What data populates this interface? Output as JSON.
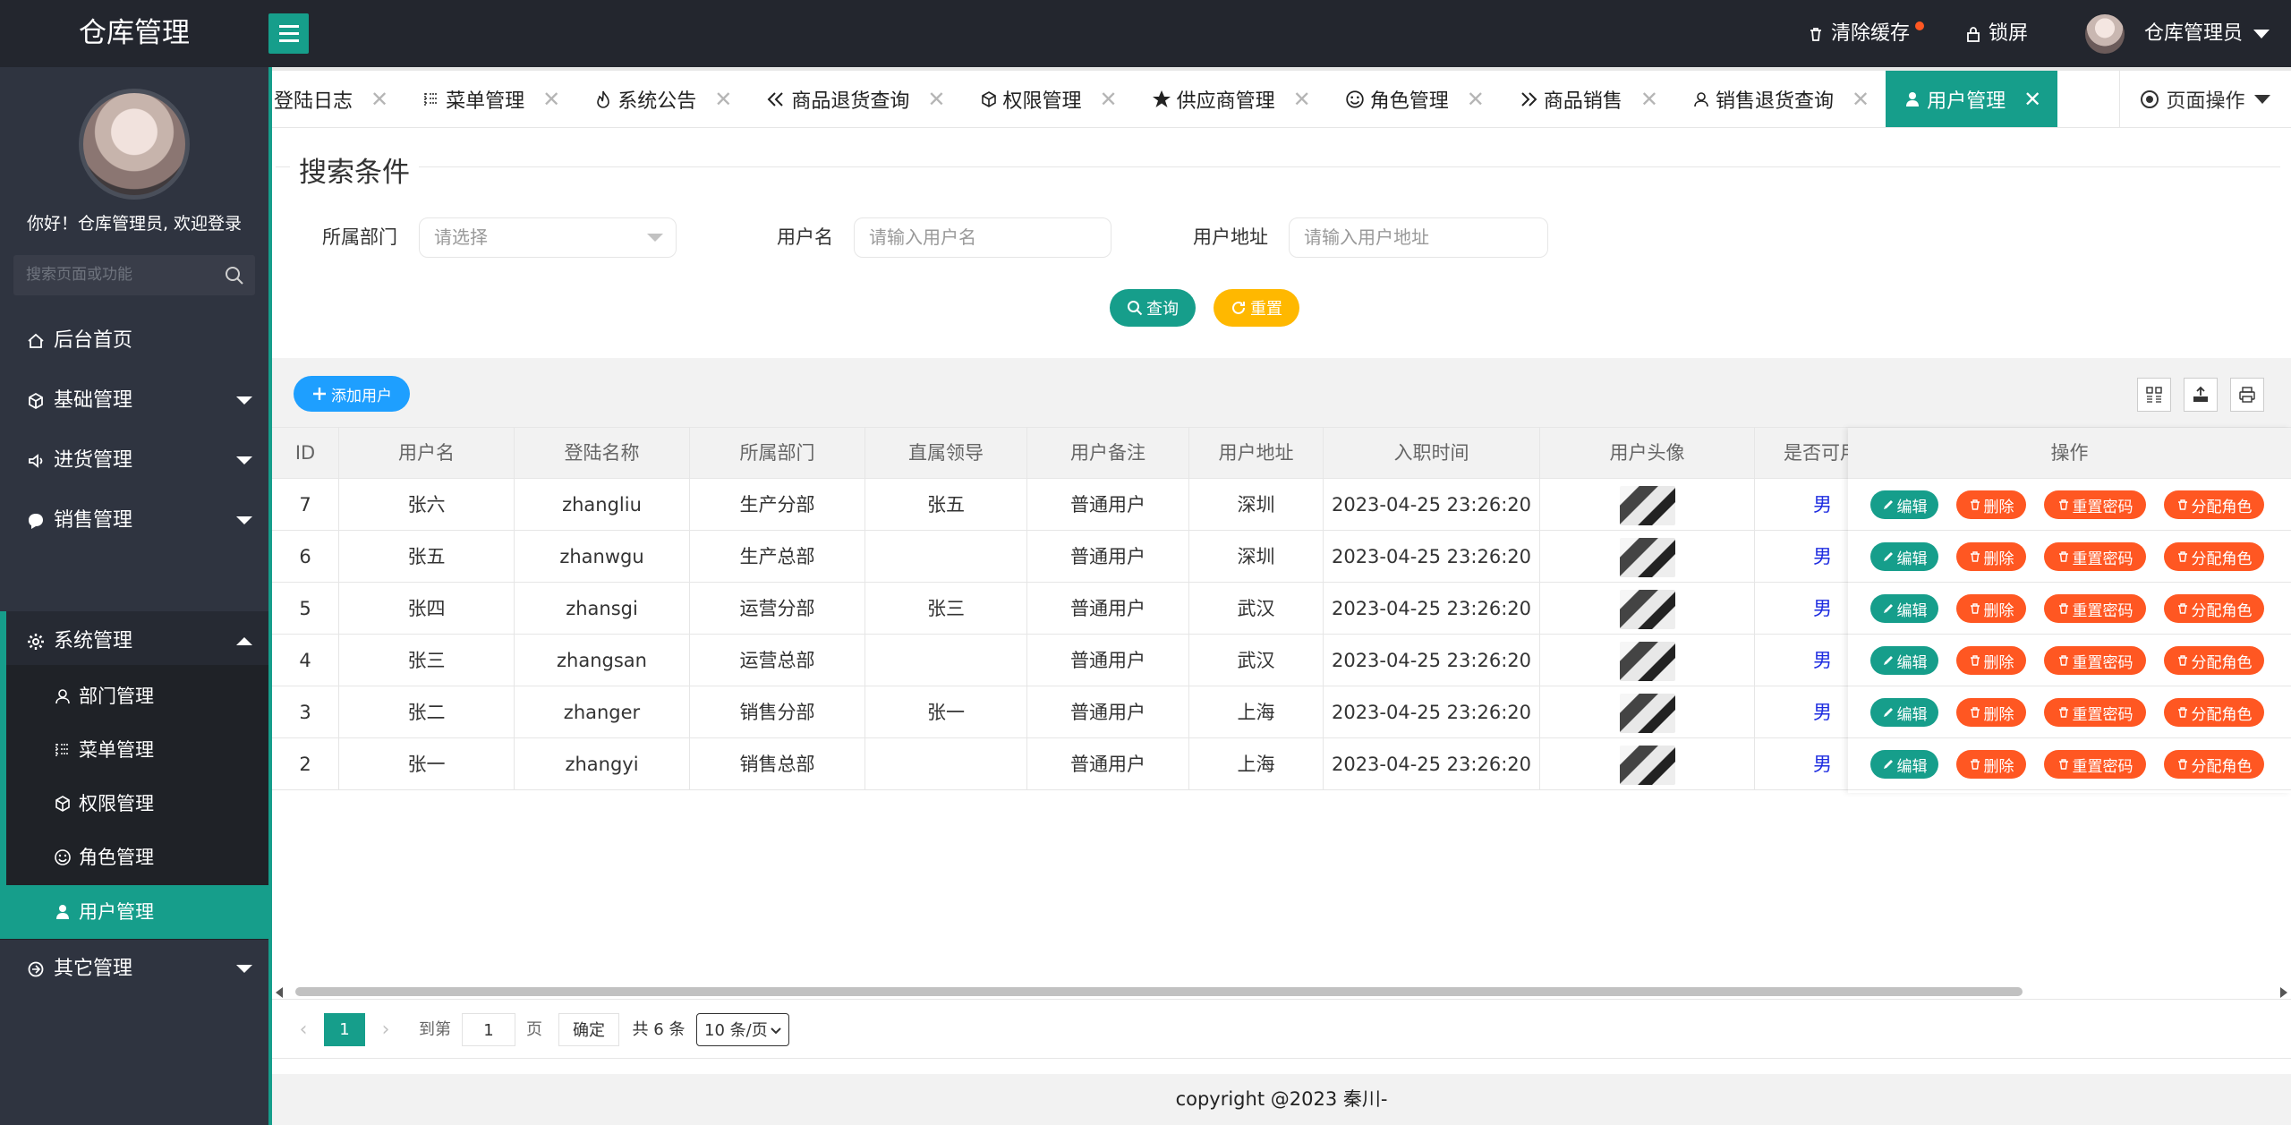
{
  "app": {
    "title": "仓库管理"
  },
  "header": {
    "clear_cache": "清除缓存",
    "lock_screen": "锁屏",
    "user": "仓库管理员"
  },
  "sidebar": {
    "welcome": "你好！仓库管理员, 欢迎登录",
    "search_placeholder": "搜索页面或功能",
    "items": [
      {
        "label": "后台首页",
        "icon": "home-icon"
      },
      {
        "label": "基础管理",
        "icon": "cube-icon"
      },
      {
        "label": "进货管理",
        "icon": "volume-icon"
      },
      {
        "label": "销售管理",
        "icon": "chat-icon"
      },
      {
        "label": "系统管理",
        "icon": "gear-icon"
      },
      {
        "label": "其它管理",
        "icon": "refresh-icon"
      }
    ],
    "sub_items": [
      {
        "label": "部门管理",
        "icon": "user-outline-icon"
      },
      {
        "label": "菜单管理",
        "icon": "list-icon"
      },
      {
        "label": "权限管理",
        "icon": "cube-icon"
      },
      {
        "label": "角色管理",
        "icon": "smile-icon"
      },
      {
        "label": "用户管理",
        "icon": "user-icon"
      }
    ]
  },
  "tabs": [
    {
      "label": "登陆日志",
      "icon": ""
    },
    {
      "label": "菜单管理",
      "icon": "list-icon"
    },
    {
      "label": "系统公告",
      "icon": "fire-icon"
    },
    {
      "label": "商品退货查询",
      "icon": "double-left-icon"
    },
    {
      "label": "权限管理",
      "icon": "cube-icon"
    },
    {
      "label": "供应商管理",
      "icon": "star-icon"
    },
    {
      "label": "角色管理",
      "icon": "smile-icon"
    },
    {
      "label": "商品销售",
      "icon": "double-right-icon"
    },
    {
      "label": "销售退货查询",
      "icon": "user-outline-icon"
    },
    {
      "label": "用户管理",
      "icon": "user-icon"
    }
  ],
  "tab_ops": "页面操作",
  "search": {
    "title": "搜索条件",
    "dept_label": "所属部门",
    "dept_placeholder": "请选择",
    "username_label": "用户名",
    "username_placeholder": "请输入用户名",
    "address_label": "用户地址",
    "address_placeholder": "请输入用户地址",
    "query_btn": "查询",
    "reset_btn": "重置",
    "query_color": "#169e8b",
    "reset_color": "#ffb800"
  },
  "table": {
    "add_btn": "添加用户",
    "columns": [
      "ID",
      "用户名",
      "登陆名称",
      "所属部门",
      "直属领导",
      "用户备注",
      "用户地址",
      "入职时间",
      "用户头像",
      "是否可用"
    ],
    "ops_header": "操作",
    "ops": {
      "edit": "编辑",
      "delete": "删除",
      "reset_pwd": "重置密码",
      "assign_role": "分配角色"
    },
    "rows": [
      [
        "7",
        "张六",
        "zhangliu",
        "生产分部",
        "张五",
        "普通用户",
        "深圳",
        "2023-04-25 23:26:20",
        "",
        "男"
      ],
      [
        "6",
        "张五",
        "zhanwgu",
        "生产总部",
        "",
        "普通用户",
        "深圳",
        "2023-04-25 23:26:20",
        "",
        "男"
      ],
      [
        "5",
        "张四",
        "zhansgi",
        "运营分部",
        "张三",
        "普通用户",
        "武汉",
        "2023-04-25 23:26:20",
        "",
        "男"
      ],
      [
        "4",
        "张三",
        "zhangsan",
        "运营总部",
        "",
        "普通用户",
        "武汉",
        "2023-04-25 23:26:20",
        "",
        "男"
      ],
      [
        "3",
        "张二",
        "zhanger",
        "销售分部",
        "张一",
        "普通用户",
        "上海",
        "2023-04-25 23:26:20",
        "",
        "男"
      ],
      [
        "2",
        "张一",
        "zhangyi",
        "销售总部",
        "",
        "普通用户",
        "上海",
        "2023-04-25 23:26:20",
        "",
        "男"
      ]
    ]
  },
  "pager": {
    "current": "1",
    "goto_label": "到第",
    "goto_value": "1",
    "page_label": "页",
    "confirm": "确定",
    "total": "共 6 条",
    "page_size": "10 条/页"
  },
  "footer": "copyright @2023 秦川-",
  "colors": {
    "accent": "#169e8b",
    "header_bg": "#23262e",
    "sidebar_bg": "#2f3440",
    "danger": "#ff5722",
    "info": "#1e9fff"
  }
}
